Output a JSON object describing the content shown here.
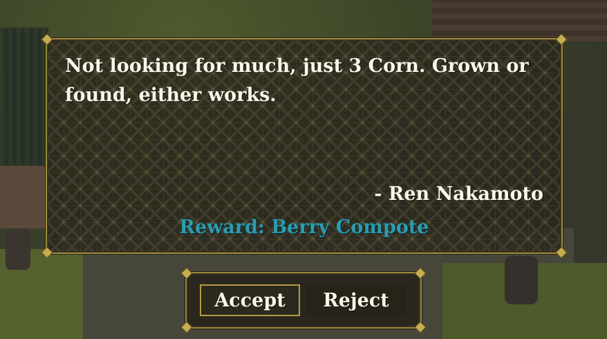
{
  "dialog": {
    "message": "Not looking for much, just 3 Corn. Grown or found, either works.",
    "signature": "- Ren Nakamoto",
    "reward": "Reward: Berry Compote"
  },
  "choices": {
    "accept_label": "Accept",
    "reject_label": "Reject",
    "selected": "Accept"
  },
  "colors": {
    "frame": "#9e8a3e",
    "text": "#fbf6ea",
    "reward": "#2a9db0"
  }
}
